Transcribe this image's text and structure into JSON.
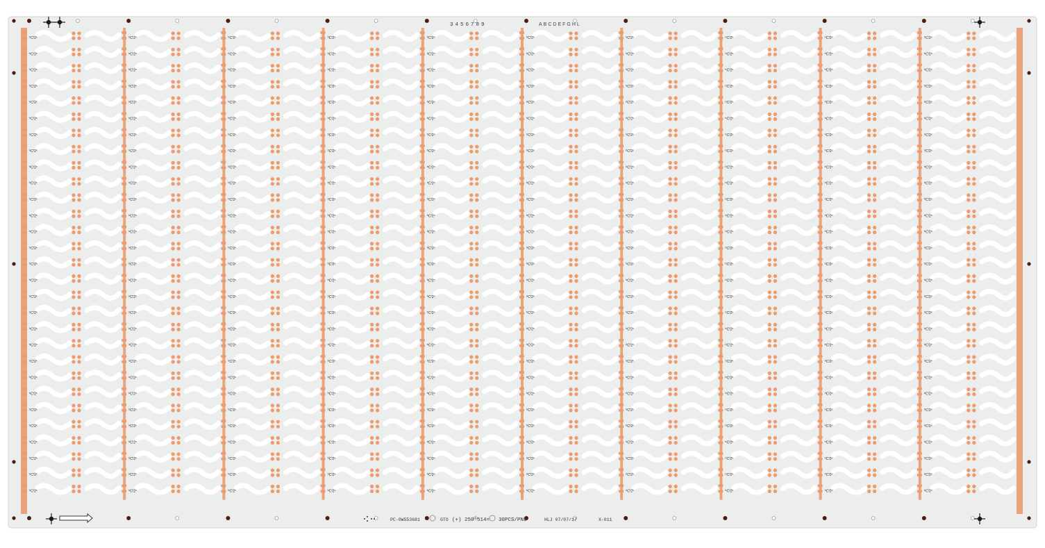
{
  "board": {
    "columns": 10,
    "rows_per_column": 29,
    "substrate_color": "#eceeee",
    "copper_color": "#e9a37d",
    "pad_color": "#ee9a6a",
    "hole_color": "#4a1e10",
    "cutout_color": "#ffffff",
    "silk_color": "#333333",
    "module_label": "ᵇCᴵ2ᵛ"
  },
  "markings": {
    "digits": "3456789",
    "letters": "ABCDEFGHL",
    "part_number": "PC-0W553681",
    "layer": "GTO",
    "polarity_dimensions": "(+) 250*514=",
    "panel_count": "30PCS/PNL",
    "date_code": "HLJ 07/07/17",
    "code": "X-011"
  },
  "icons": {
    "fiducial": "crosshair-fiducial-icon",
    "direction_arrow": "direction-arrow-icon"
  }
}
